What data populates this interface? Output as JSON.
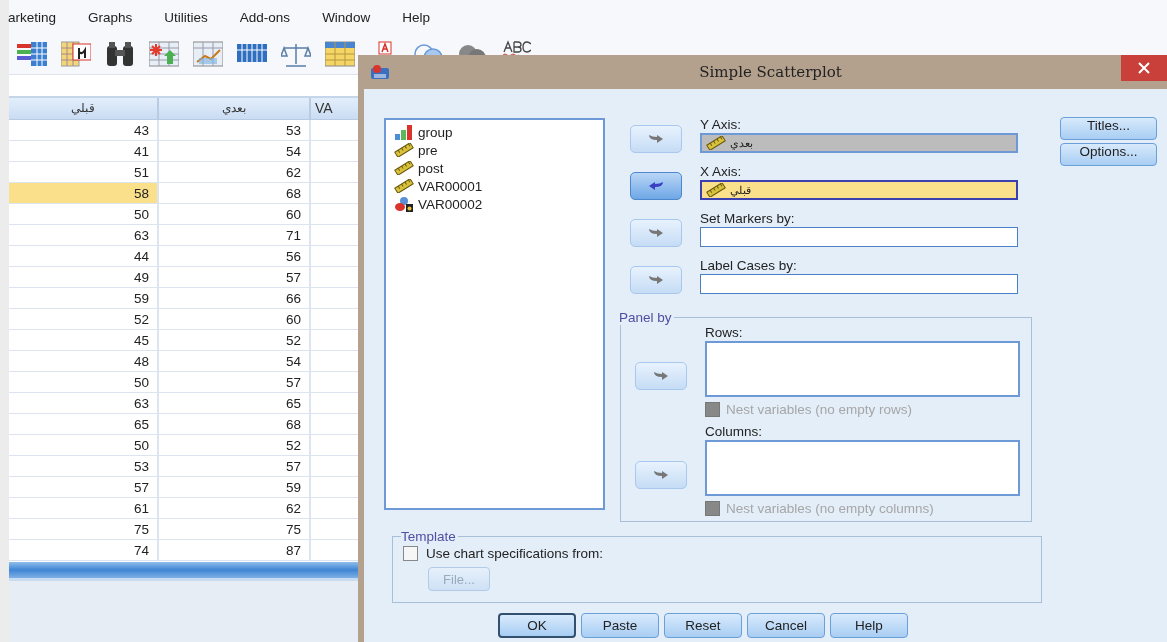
{
  "menu": [
    {
      "label": "arketing"
    },
    {
      "label": "Graphs"
    },
    {
      "label": "Utilities"
    },
    {
      "label": "Add-ons"
    },
    {
      "label": "Window"
    },
    {
      "label": "Help"
    }
  ],
  "toolbar": [
    {
      "kind": "variables"
    },
    {
      "kind": "stats-table"
    },
    {
      "kind": "find"
    },
    {
      "kind": "insert-cases"
    },
    {
      "kind": "chart-table"
    },
    {
      "kind": "grid"
    },
    {
      "kind": "scale"
    },
    {
      "kind": "split-table"
    },
    {
      "kind": "value-labels"
    },
    {
      "kind": "sets"
    },
    {
      "kind": "sets-grey"
    },
    {
      "kind": "spell"
    }
  ],
  "table": {
    "columns": [
      "قبلي",
      "بعدي",
      "VA"
    ],
    "rows": [
      {
        "cells": [
          {
            "text": "43",
            "selected": false
          },
          {
            "text": "53",
            "selected": false
          }
        ]
      },
      {
        "cells": [
          {
            "text": "41",
            "selected": false
          },
          {
            "text": "54",
            "selected": false
          }
        ]
      },
      {
        "cells": [
          {
            "text": "51",
            "selected": false
          },
          {
            "text": "62",
            "selected": false
          }
        ]
      },
      {
        "cells": [
          {
            "text": "58",
            "selected": true
          },
          {
            "text": "68",
            "selected": false
          }
        ]
      },
      {
        "cells": [
          {
            "text": "50",
            "selected": false
          },
          {
            "text": "60",
            "selected": false
          }
        ]
      },
      {
        "cells": [
          {
            "text": "63",
            "selected": false
          },
          {
            "text": "71",
            "selected": false
          }
        ]
      },
      {
        "cells": [
          {
            "text": "44",
            "selected": false
          },
          {
            "text": "56",
            "selected": false
          }
        ]
      },
      {
        "cells": [
          {
            "text": "49",
            "selected": false
          },
          {
            "text": "57",
            "selected": false
          }
        ]
      },
      {
        "cells": [
          {
            "text": "59",
            "selected": false
          },
          {
            "text": "66",
            "selected": false
          }
        ]
      },
      {
        "cells": [
          {
            "text": "52",
            "selected": false
          },
          {
            "text": "60",
            "selected": false
          }
        ]
      },
      {
        "cells": [
          {
            "text": "45",
            "selected": false
          },
          {
            "text": "52",
            "selected": false
          }
        ]
      },
      {
        "cells": [
          {
            "text": "48",
            "selected": false
          },
          {
            "text": "54",
            "selected": false
          }
        ]
      },
      {
        "cells": [
          {
            "text": "50",
            "selected": false
          },
          {
            "text": "57",
            "selected": false
          }
        ]
      },
      {
        "cells": [
          {
            "text": "63",
            "selected": false
          },
          {
            "text": "65",
            "selected": false
          }
        ]
      },
      {
        "cells": [
          {
            "text": "65",
            "selected": false
          },
          {
            "text": "68",
            "selected": false
          }
        ]
      },
      {
        "cells": [
          {
            "text": "50",
            "selected": false
          },
          {
            "text": "52",
            "selected": false
          }
        ]
      },
      {
        "cells": [
          {
            "text": "53",
            "selected": false
          },
          {
            "text": "57",
            "selected": false
          }
        ]
      },
      {
        "cells": [
          {
            "text": "57",
            "selected": false
          },
          {
            "text": "59",
            "selected": false
          }
        ]
      },
      {
        "cells": [
          {
            "text": "61",
            "selected": false
          },
          {
            "text": "62",
            "selected": false
          }
        ]
      },
      {
        "cells": [
          {
            "text": "75",
            "selected": false
          },
          {
            "text": "75",
            "selected": false
          }
        ]
      },
      {
        "cells": [
          {
            "text": "74",
            "selected": false
          },
          {
            "text": "87",
            "selected": false
          }
        ]
      }
    ]
  },
  "dialog": {
    "title": "Simple Scatterplot",
    "variables": [
      {
        "name": "group",
        "kind": "ordinal"
      },
      {
        "name": "pre",
        "kind": "scale"
      },
      {
        "name": "post",
        "kind": "scale"
      },
      {
        "name": "VAR00001",
        "kind": "scale"
      },
      {
        "name": "VAR00002",
        "kind": "nominal"
      }
    ],
    "targets": [
      {
        "label": "Y Axis:",
        "value": "بعدي",
        "selected": false
      },
      {
        "label": "X Axis:",
        "value": "قبلي",
        "selected": true
      },
      {
        "label": "Set Markers by:",
        "selected": false
      },
      {
        "label": "Label Cases by:",
        "selected": false
      }
    ],
    "panel": {
      "title": "Panel by",
      "lists": [
        {
          "label": "Rows:",
          "nest": {
            "label": "Nest variables (no empty rows)",
            "checked": false,
            "disabled": true
          }
        },
        {
          "label": "Columns:",
          "nest": {
            "label": "Nest variables (no empty columns)",
            "checked": false,
            "disabled": true
          }
        }
      ]
    },
    "side_buttons": [
      "Titles...",
      "Options..."
    ],
    "template": {
      "title": "Template",
      "checkbox": {
        "label": "Use chart specifications from:",
        "checked": false
      },
      "file_button": {
        "label": "File...",
        "disabled": true
      }
    },
    "buttons": [
      {
        "label": "OK",
        "default": true
      },
      {
        "label": "Paste",
        "default": false
      },
      {
        "label": "Reset",
        "default": false
      },
      {
        "label": "Cancel",
        "default": false
      },
      {
        "label": "Help",
        "default": false
      }
    ]
  }
}
